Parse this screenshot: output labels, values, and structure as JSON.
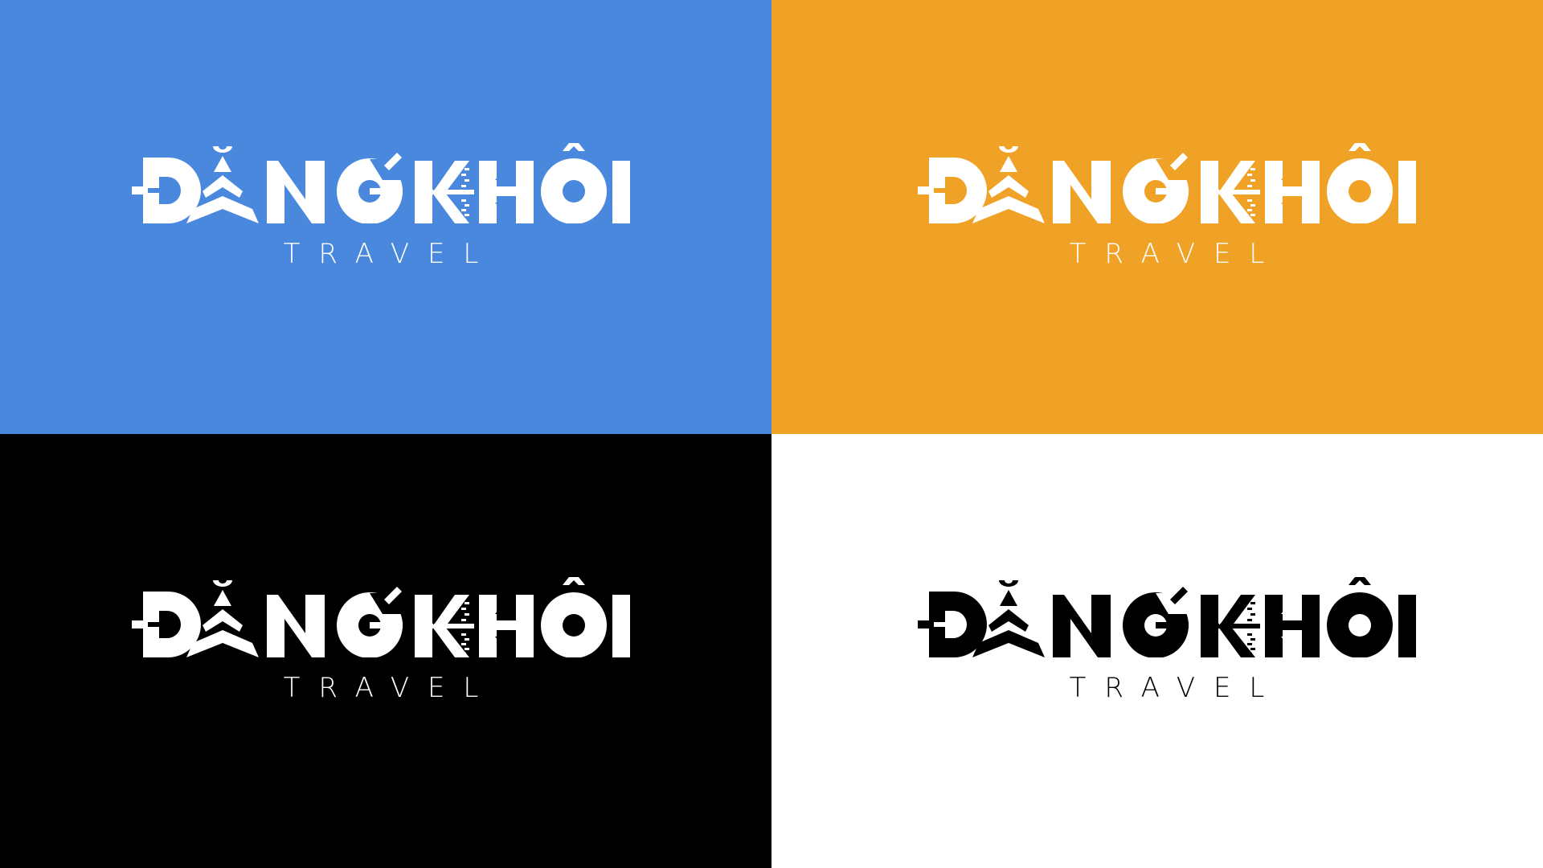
{
  "variants": [
    {
      "background": "#4A88DD",
      "foreground": "#FFFFFF",
      "brand": "ĐĂNG KHÔI",
      "tagline": "TRAVEL"
    },
    {
      "background": "#F0A227",
      "foreground": "#FFFFFF",
      "brand": "ĐĂNG KHÔI",
      "tagline": "TRAVEL"
    },
    {
      "background": "#000000",
      "foreground": "#FFFFFF",
      "brand": "ĐĂNG KHÔI",
      "tagline": "TRAVEL"
    },
    {
      "background": "#FFFFFF",
      "foreground": "#000000",
      "brand": "ĐĂNG KHÔI",
      "tagline": "TRAVEL"
    }
  ]
}
